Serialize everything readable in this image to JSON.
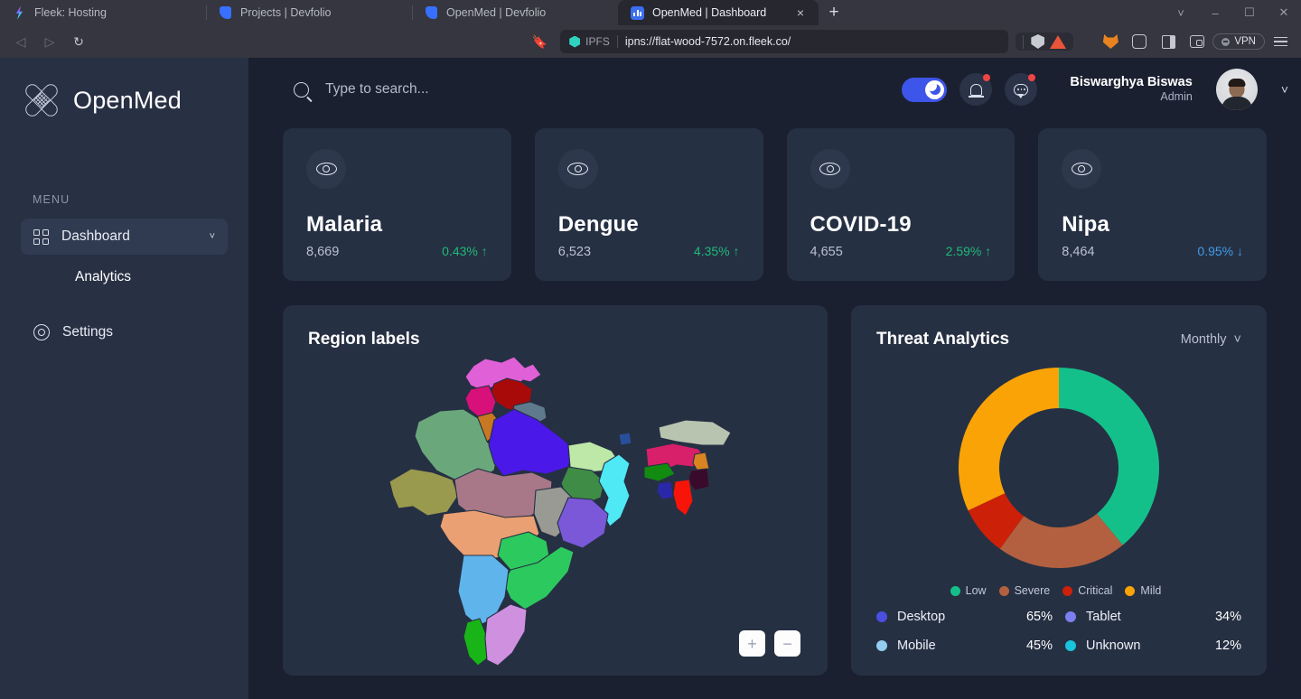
{
  "browser": {
    "tabs": [
      {
        "title": "Fleek: Hosting",
        "favicon": "fleek-icon",
        "active": false
      },
      {
        "title": "Projects | Devfolio",
        "favicon": "devfolio-icon",
        "active": false
      },
      {
        "title": "OpenMed | Devfolio",
        "favicon": "devfolio-icon",
        "active": false
      },
      {
        "title": "OpenMed | Dashboard",
        "favicon": "dashboard-chart-icon",
        "active": true
      }
    ],
    "new_tab_label": "+",
    "close_label": "×",
    "window_controls": [
      "chevron-down-icon",
      "minimize-icon",
      "maximize-icon",
      "close-icon"
    ],
    "nav": {
      "back": "◁",
      "forward": "▷",
      "reload": "↻",
      "bookmark": "bookmark-icon"
    },
    "url": {
      "protocol_badge": "IPFS",
      "value": "ipns://flat-wood-7572.on.fleek.co/"
    },
    "extensions": [
      "brave-shield-icon",
      "brave-rewards-icon",
      "metamask-fox-icon",
      "puzzle-extensions-icon",
      "side-panel-icon",
      "wallet-icon"
    ],
    "vpn_label": "VPN",
    "menu_label": "browser-menu"
  },
  "sidebar": {
    "brand": "OpenMed",
    "menu_heading": "MENU",
    "items": [
      {
        "label": "Dashboard",
        "icon": "grid-icon",
        "active": true,
        "expanded": true
      },
      {
        "label": "Analytics",
        "icon": "",
        "sub": true
      },
      {
        "label": "Settings",
        "icon": "gear-icon",
        "active": false
      }
    ]
  },
  "topbar": {
    "search": {
      "placeholder": "Type to search...",
      "value": "",
      "icon": "search-icon"
    },
    "theme_toggle": {
      "state": "dark",
      "icon": "moon-icon"
    },
    "notifications": {
      "icon": "bell-icon",
      "has_badge": true
    },
    "messages": {
      "icon": "chat-icon",
      "has_badge": true
    },
    "user": {
      "name": "Biswarghya Biswas",
      "role": "Admin",
      "avatar": "user-avatar",
      "caret": "chevron-down-icon"
    }
  },
  "stats": [
    {
      "title": "Malaria",
      "value": "8,669",
      "delta": "0.43%",
      "direction": "up",
      "color": "#1fb978",
      "icon": "eye-icon"
    },
    {
      "title": "Dengue",
      "value": "6,523",
      "delta": "4.35%",
      "direction": "up",
      "color": "#1fb978",
      "icon": "eye-icon"
    },
    {
      "title": "COVID-19",
      "value": "4,655",
      "delta": "2.59%",
      "direction": "up",
      "color": "#1fb978",
      "icon": "eye-icon"
    },
    {
      "title": "Nipa",
      "value": "8,464",
      "delta": "0.95%",
      "direction": "down",
      "color": "#3e9ce8",
      "icon": "eye-icon"
    }
  ],
  "map_panel": {
    "title": "Region labels",
    "zoom_in": "+",
    "zoom_out": "−"
  },
  "threat_panel": {
    "title": "Threat Analytics",
    "period": "Monthly",
    "period_caret": "chevron-down-icon"
  },
  "chart_data": {
    "type": "pie",
    "title": "Threat Analytics",
    "subtitle": "Monthly",
    "legend_position": "bottom",
    "categories": [
      "Low",
      "Severe",
      "Critical",
      "Mild"
    ],
    "values": [
      39,
      21,
      8,
      32
    ],
    "colors": [
      "#14c08a",
      "#b2603f",
      "#cc2008",
      "#f9a307"
    ],
    "unit": "%"
  },
  "devices": [
    {
      "label": "Desktop",
      "value": "65%",
      "color": "#4a4fe0"
    },
    {
      "label": "Tablet",
      "value": "34%",
      "color": "#7b7ff0"
    },
    {
      "label": "Mobile",
      "value": "45%",
      "color": "#93cdf0"
    },
    {
      "label": "Unknown",
      "value": "12%",
      "color": "#19c2dd"
    }
  ],
  "map_regions": [
    {
      "name": "jammu-kashmir",
      "color": "#e060d8"
    },
    {
      "name": "ladakh",
      "color": "#a80a0a"
    },
    {
      "name": "himachal",
      "color": "#d8107a"
    },
    {
      "name": "punjab",
      "color": "#c87820"
    },
    {
      "name": "uttarakhand",
      "color": "#5f7a8c"
    },
    {
      "name": "haryana",
      "color": "#3ec28c"
    },
    {
      "name": "rajasthan",
      "color": "#6aa87c"
    },
    {
      "name": "uttar-pradesh",
      "color": "#4a18e8"
    },
    {
      "name": "bihar",
      "color": "#bde8a8"
    },
    {
      "name": "gujarat",
      "color": "#9a9a4e"
    },
    {
      "name": "madhya-pradesh",
      "color": "#a87888"
    },
    {
      "name": "jharkhand",
      "color": "#3f8c46"
    },
    {
      "name": "west-bengal",
      "color": "#4fe8f5"
    },
    {
      "name": "sikkim",
      "color": "#2a4f9a"
    },
    {
      "name": "assam",
      "color": "#d8206a"
    },
    {
      "name": "meghalaya",
      "color": "#118c11"
    },
    {
      "name": "arunachal",
      "color": "#b8c3b0"
    },
    {
      "name": "nagaland",
      "color": "#d88420"
    },
    {
      "name": "manipur",
      "color": "#3a0a2a"
    },
    {
      "name": "mizoram",
      "color": "#f81408"
    },
    {
      "name": "tripura",
      "color": "#2a28a8"
    },
    {
      "name": "chhattisgarh",
      "color": "#9a9a94"
    },
    {
      "name": "odisha",
      "color": "#7a58d8"
    },
    {
      "name": "maharashtra",
      "color": "#eaa072"
    },
    {
      "name": "telangana",
      "color": "#2cc95e"
    },
    {
      "name": "karnataka",
      "color": "#5fb4ec"
    },
    {
      "name": "andhra",
      "color": "#2cc95e"
    },
    {
      "name": "kerala",
      "color": "#19b417"
    },
    {
      "name": "tamil-nadu",
      "color": "#cf90e0"
    }
  ]
}
